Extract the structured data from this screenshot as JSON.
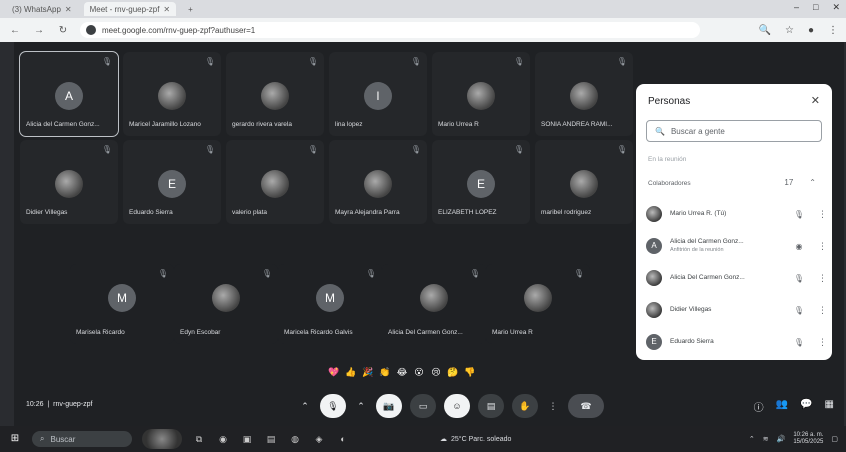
{
  "browser": {
    "tabs": [
      {
        "label": "(3) WhatsApp",
        "active": false
      },
      {
        "label": "Meet - rnv-guep-zpf",
        "active": true
      }
    ],
    "new_tab": "+",
    "window_controls": [
      "–",
      "□",
      "✕"
    ],
    "url": "meet.google.com/rnv-guep-zpf?authuser=1"
  },
  "meet": {
    "tiles_row1": [
      {
        "name": "Alicia del Carmen Gonz...",
        "initial": "A",
        "type": "letter",
        "selected": true
      },
      {
        "name": "Maricel Jaramillo Lozano",
        "initial": "",
        "type": "photo"
      },
      {
        "name": "gerardo rivera varela",
        "initial": "",
        "type": "photo"
      },
      {
        "name": "lina lopez",
        "initial": "l",
        "type": "letter"
      },
      {
        "name": "Mario Urrea R",
        "initial": "",
        "type": "photo"
      },
      {
        "name": "SONIA ANDREA RAMI...",
        "initial": "",
        "type": "photo"
      }
    ],
    "tiles_row2": [
      {
        "name": "Didier Villegas",
        "initial": "",
        "type": "photo"
      },
      {
        "name": "Eduardo Sierra",
        "initial": "E",
        "type": "letter"
      },
      {
        "name": "valerio plata",
        "initial": "",
        "type": "photo"
      },
      {
        "name": "Mayra Alejandra Parra",
        "initial": "",
        "type": "photo"
      },
      {
        "name": "ELIZABETH LOPEZ",
        "initial": "E",
        "type": "letter"
      },
      {
        "name": "maribel rodriguez",
        "initial": "",
        "type": "photo"
      }
    ],
    "tiles_row3": [
      {
        "name": "Marisela Ricardo",
        "initial": "M",
        "type": "letter"
      },
      {
        "name": "Edyn Escobar",
        "initial": "",
        "type": "photo"
      },
      {
        "name": "Maricela Ricardo Galvis",
        "initial": "M",
        "type": "letter"
      },
      {
        "name": "Alicia Del Carmen Gonz...",
        "initial": "",
        "type": "photo"
      },
      {
        "name": "Mario Urrea R",
        "initial": "",
        "type": "photo"
      }
    ],
    "meeting_time": "10:26",
    "meeting_code": "rnv-guep-zpf"
  },
  "panel": {
    "title": "Personas",
    "close": "✕",
    "search_placeholder": "Buscar a gente",
    "subtitle": "En la reunión",
    "group_label": "Colaboradores",
    "group_count": "17",
    "people": [
      {
        "name": "Mario Urrea R. (Tú)",
        "sub": "",
        "avatar": "photo"
      },
      {
        "name": "Alicia del Carmen Gonz...",
        "sub": "Anfitrión de la reunión",
        "avatar": "letter",
        "initial": "A"
      },
      {
        "name": "Alicia Del Carmen Gonz...",
        "sub": "",
        "avatar": "photo"
      },
      {
        "name": "Didier Villegas",
        "sub": "",
        "avatar": "photo"
      },
      {
        "name": "Eduardo Sierra",
        "sub": "",
        "avatar": "letter",
        "initial": "E"
      }
    ]
  },
  "reactions": [
    "💖",
    "👍",
    "🎉",
    "👏",
    "😂",
    "😮",
    "😢",
    "🤔",
    "👎"
  ],
  "taskbar": {
    "search": "Buscar",
    "weather": "25°C  Parc. soleado",
    "time": "10:26 a. m.",
    "date": "15/05/2025"
  },
  "colors": {
    "meet_bg": "#1f2124",
    "tile_bg": "#25272a",
    "panel_bg": "#ffffff",
    "taskbar_bg": "#202124"
  }
}
